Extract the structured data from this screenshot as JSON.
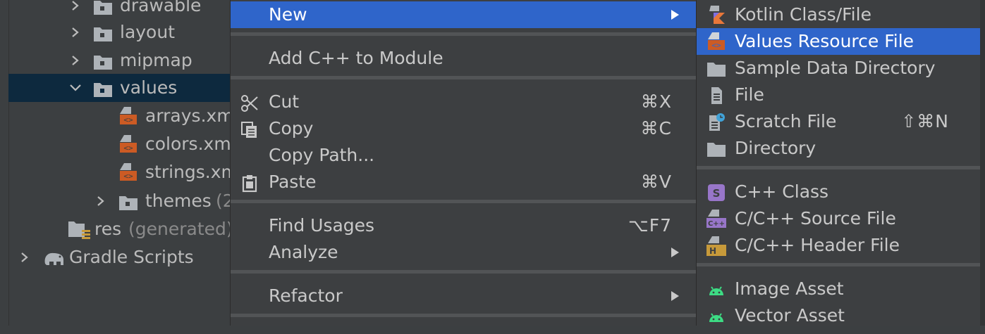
{
  "tree": {
    "rows": [
      {
        "label": "drawable",
        "extra": "",
        "expanded": false,
        "icon": "folder-icon"
      },
      {
        "label": "layout",
        "extra": "",
        "expanded": false,
        "icon": "folder-icon"
      },
      {
        "label": "mipmap",
        "extra": "",
        "expanded": false,
        "icon": "folder-icon"
      },
      {
        "label": "values",
        "extra": "",
        "expanded": true,
        "icon": "folder-icon",
        "selected": true
      },
      {
        "label": "arrays.xm",
        "extra": "",
        "icon": "xml-file-icon"
      },
      {
        "label": "colors.xm",
        "extra": "",
        "icon": "xml-file-icon"
      },
      {
        "label": "strings.xm",
        "extra": "",
        "icon": "xml-file-icon"
      },
      {
        "label": "themes",
        "extra": "(2",
        "expanded": false,
        "icon": "folder-icon"
      },
      {
        "label": "res",
        "extra": "(generated)",
        "icon": "generated-res-folder-icon"
      },
      {
        "label": "Gradle Scripts",
        "extra": "",
        "expanded": false,
        "icon": "gradle-elephant-icon"
      }
    ]
  },
  "menu": {
    "new": "New",
    "add_cpp": "Add C++ to Module",
    "cut": "Cut",
    "cut_sc": "⌘X",
    "copy": "Copy",
    "copy_sc": "⌘C",
    "copy_path": "Copy Path...",
    "paste": "Paste",
    "paste_sc": "⌘V",
    "find_usages": "Find Usages",
    "find_usages_sc": "⌥F7",
    "analyze": "Analyze",
    "refactor": "Refactor"
  },
  "submenu": {
    "kotlin": "Kotlin Class/File",
    "values_res": "Values Resource File",
    "sample_data": "Sample Data Directory",
    "file": "File",
    "scratch": "Scratch File",
    "scratch_sc": "⇧⌘N",
    "directory": "Directory",
    "cpp_class": "C++ Class",
    "c_source": "C/C++ Source File",
    "c_header": "C/C++ Header File",
    "image_asset": "Image Asset",
    "vector_asset": "Vector Asset"
  },
  "colors": {
    "highlight": "#2f65ca",
    "tree_selected": "#0d293e",
    "xml_icon": "#cc5b24",
    "android_green": "#3ddc84",
    "cpp_purple": "#9876c9",
    "header_yellow": "#c79a3a"
  }
}
